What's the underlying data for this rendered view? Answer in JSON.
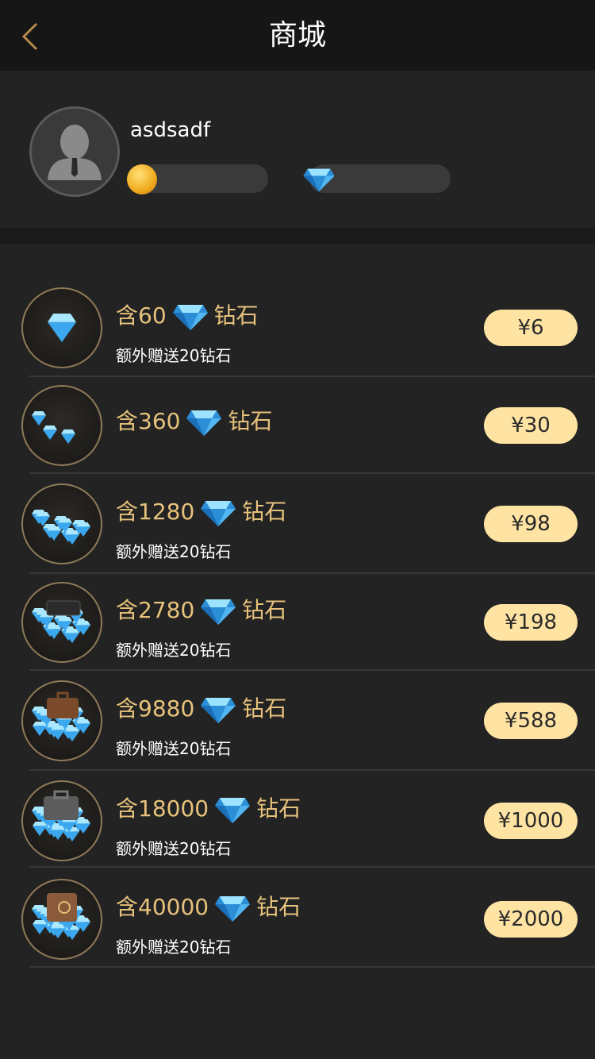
{
  "nav": {
    "title": "商城"
  },
  "profile": {
    "username": "asdsadf",
    "coins": "",
    "diamonds": ""
  },
  "packs": [
    {
      "amount": "含60",
      "unit": "钻石",
      "bonus": "额外赠送20钻石",
      "price": "¥6"
    },
    {
      "amount": "含360",
      "unit": "钻石",
      "bonus": "",
      "price": "¥30"
    },
    {
      "amount": "含1280",
      "unit": "钻石",
      "bonus": "额外赠送20钻石",
      "price": "¥98"
    },
    {
      "amount": "含2780",
      "unit": "钻石",
      "bonus": "额外赠送20钻石",
      "price": "¥198"
    },
    {
      "amount": "含9880",
      "unit": "钻石",
      "bonus": "额外赠送20钻石",
      "price": "¥588"
    },
    {
      "amount": "含18000",
      "unit": "钻石",
      "bonus": "额外赠送20钻石",
      "price": "¥1000"
    },
    {
      "amount": "含40000",
      "unit": "钻石",
      "bonus": "额外赠送20钻石",
      "price": "¥2000"
    }
  ],
  "colors": {
    "accent_gold": "#e7c27c",
    "price_bg": "#ffe3a3",
    "background": "#232323",
    "nav_bg": "#161616"
  },
  "icons": {
    "back": "chevron-left-icon",
    "coin": "coin-icon",
    "diamond": "diamond-icon",
    "avatar": "avatar-silhouette-icon"
  }
}
